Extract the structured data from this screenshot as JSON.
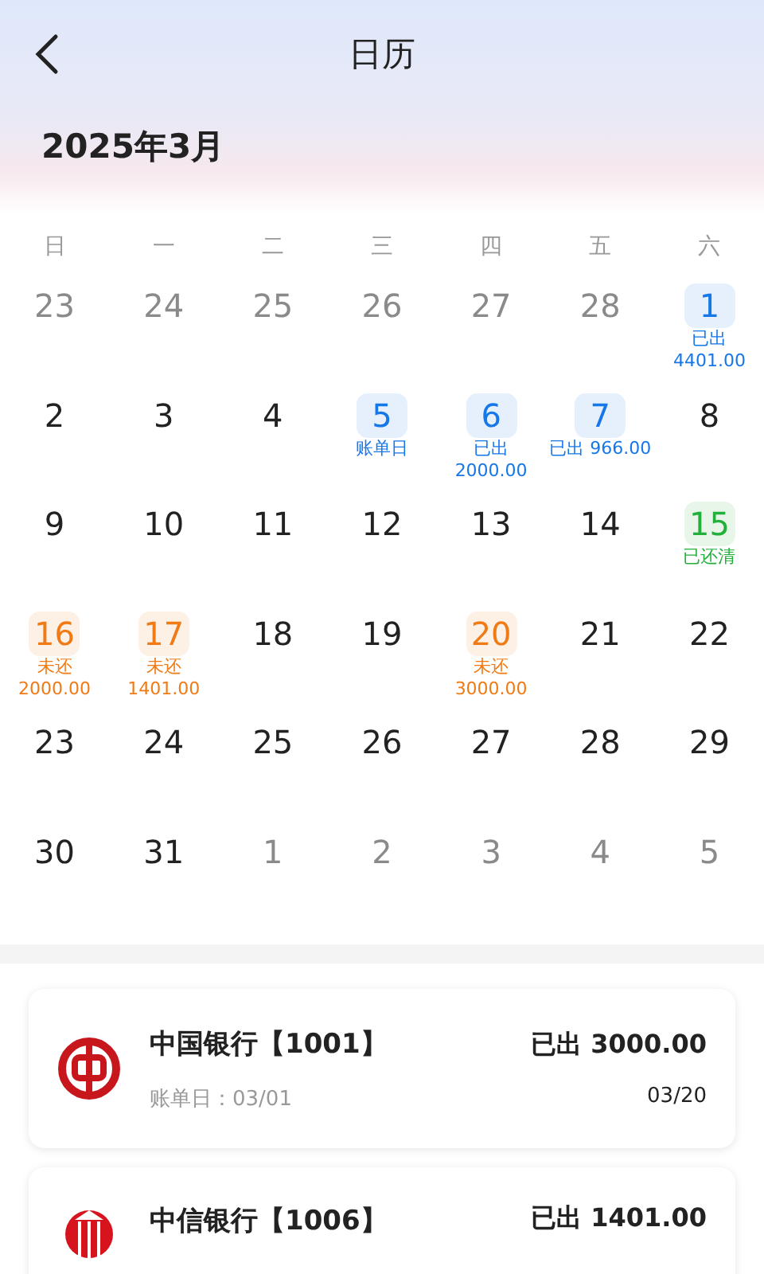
{
  "header": {
    "title": "日历",
    "month": "2025年3月"
  },
  "weekdays": [
    "日",
    "一",
    "二",
    "三",
    "四",
    "五",
    "六"
  ],
  "days": [
    {
      "day": "23",
      "kind": "other"
    },
    {
      "day": "24",
      "kind": "other"
    },
    {
      "day": "25",
      "kind": "other"
    },
    {
      "day": "26",
      "kind": "other"
    },
    {
      "day": "27",
      "kind": "other"
    },
    {
      "day": "28",
      "kind": "other"
    },
    {
      "day": "1",
      "kind": "marked",
      "color": "#1677e8",
      "notes": [
        "已出",
        "4401.00"
      ]
    },
    {
      "day": "2",
      "kind": "normal"
    },
    {
      "day": "3",
      "kind": "normal"
    },
    {
      "day": "4",
      "kind": "normal"
    },
    {
      "day": "5",
      "kind": "marked",
      "color": "#1677e8",
      "notes": [
        "账单日"
      ]
    },
    {
      "day": "6",
      "kind": "marked",
      "color": "#1677e8",
      "notes": [
        "已出",
        "2000.00"
      ]
    },
    {
      "day": "7",
      "kind": "marked",
      "color": "#1677e8",
      "notes": [
        "已出 966.00"
      ]
    },
    {
      "day": "8",
      "kind": "normal"
    },
    {
      "day": "9",
      "kind": "normal"
    },
    {
      "day": "10",
      "kind": "normal"
    },
    {
      "day": "11",
      "kind": "normal"
    },
    {
      "day": "12",
      "kind": "normal"
    },
    {
      "day": "13",
      "kind": "normal"
    },
    {
      "day": "14",
      "kind": "normal"
    },
    {
      "day": "15",
      "kind": "marked",
      "color": "#22b03a",
      "notes": [
        "已还清"
      ]
    },
    {
      "day": "16",
      "kind": "marked",
      "color": "#f07a14",
      "notes": [
        "未还",
        "2000.00"
      ]
    },
    {
      "day": "17",
      "kind": "marked",
      "color": "#f07a14",
      "notes": [
        "未还",
        "1401.00"
      ]
    },
    {
      "day": "18",
      "kind": "normal"
    },
    {
      "day": "19",
      "kind": "normal"
    },
    {
      "day": "20",
      "kind": "marked",
      "color": "#f07a14",
      "notes": [
        "未还",
        "3000.00"
      ]
    },
    {
      "day": "21",
      "kind": "normal"
    },
    {
      "day": "22",
      "kind": "normal"
    },
    {
      "day": "23",
      "kind": "normal"
    },
    {
      "day": "24",
      "kind": "normal"
    },
    {
      "day": "25",
      "kind": "normal"
    },
    {
      "day": "26",
      "kind": "normal"
    },
    {
      "day": "27",
      "kind": "normal"
    },
    {
      "day": "28",
      "kind": "normal"
    },
    {
      "day": "29",
      "kind": "normal"
    },
    {
      "day": "30",
      "kind": "normal"
    },
    {
      "day": "31",
      "kind": "normal"
    },
    {
      "day": "1",
      "kind": "other"
    },
    {
      "day": "2",
      "kind": "other"
    },
    {
      "day": "3",
      "kind": "other"
    },
    {
      "day": "4",
      "kind": "other"
    },
    {
      "day": "5",
      "kind": "other"
    }
  ],
  "cards": [
    {
      "kind": "coin",
      "name": "中国银行【1001】",
      "amount": "已出 3000.00",
      "bill_day": "账单日：03/01",
      "due": "03/20"
    },
    {
      "kind": "pillars",
      "name": "中信银行【1006】",
      "amount": "已出 1401.00"
    }
  ]
}
